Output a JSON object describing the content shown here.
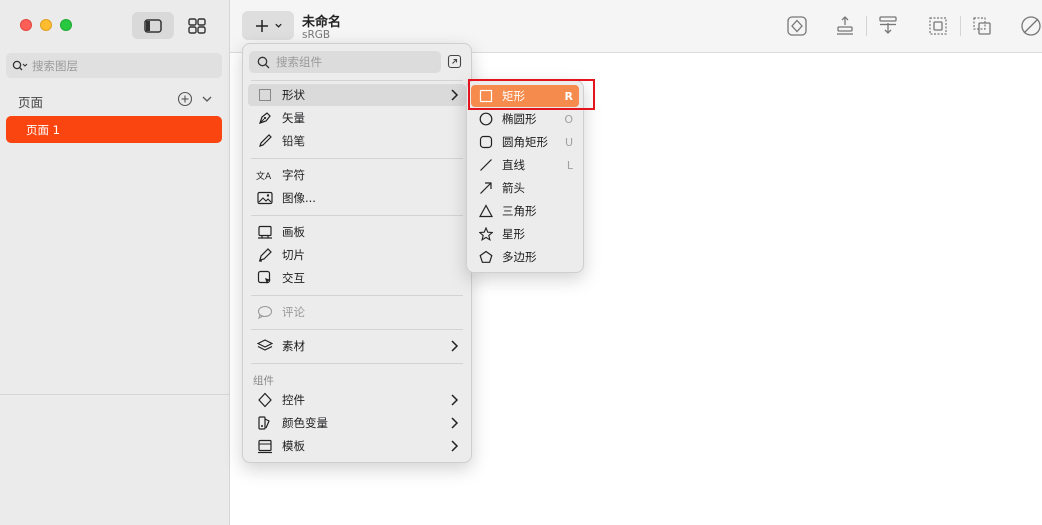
{
  "sidebar": {
    "search_placeholder": "搜索图层",
    "pages_title": "页面",
    "pages": [
      {
        "label": "页面 1",
        "selected": true
      }
    ]
  },
  "toolbar": {
    "doc_title": "未命名",
    "color_profile": "sRGB"
  },
  "insert_menu": {
    "search_placeholder": "搜索组件",
    "items": [
      {
        "label": "形状",
        "icon": "square-icon",
        "submenu": true,
        "highlighted": true
      },
      {
        "label": "矢量",
        "icon": "pen-icon"
      },
      {
        "label": "铅笔",
        "icon": "pencil-icon"
      },
      {
        "label": "字符",
        "icon": "text-icon"
      },
      {
        "label": "图像...",
        "icon": "image-icon"
      },
      {
        "label": "画板",
        "icon": "artboard-icon"
      },
      {
        "label": "切片",
        "icon": "slice-icon"
      },
      {
        "label": "交互",
        "icon": "interaction-icon"
      },
      {
        "label": "评论",
        "icon": "comment-icon",
        "disabled": true
      },
      {
        "label": "素材",
        "icon": "layers-icon",
        "submenu": true
      }
    ],
    "components_label": "组件",
    "components": [
      {
        "label": "控件",
        "icon": "diamond-icon",
        "submenu": true
      },
      {
        "label": "颜色变量",
        "icon": "color-icon",
        "submenu": true
      },
      {
        "label": "模板",
        "icon": "template-icon",
        "submenu": true
      }
    ]
  },
  "shape_submenu": {
    "items": [
      {
        "label": "矩形",
        "key": "R",
        "icon": "rectangle-icon",
        "selected": true
      },
      {
        "label": "椭圆形",
        "key": "O",
        "icon": "oval-icon"
      },
      {
        "label": "圆角矩形",
        "key": "U",
        "icon": "rounded-rectangle-icon"
      },
      {
        "label": "直线",
        "key": "L",
        "icon": "line-icon"
      },
      {
        "label": "箭头",
        "key": "",
        "icon": "arrow-icon"
      },
      {
        "label": "三角形",
        "key": "",
        "icon": "triangle-icon"
      },
      {
        "label": "星形",
        "key": "",
        "icon": "star-icon"
      },
      {
        "label": "多边形",
        "key": "",
        "icon": "polygon-icon"
      }
    ]
  },
  "colors": {
    "accent": "#fa4511",
    "selection": "#f58b4c",
    "focus_box": "#e3141e"
  }
}
